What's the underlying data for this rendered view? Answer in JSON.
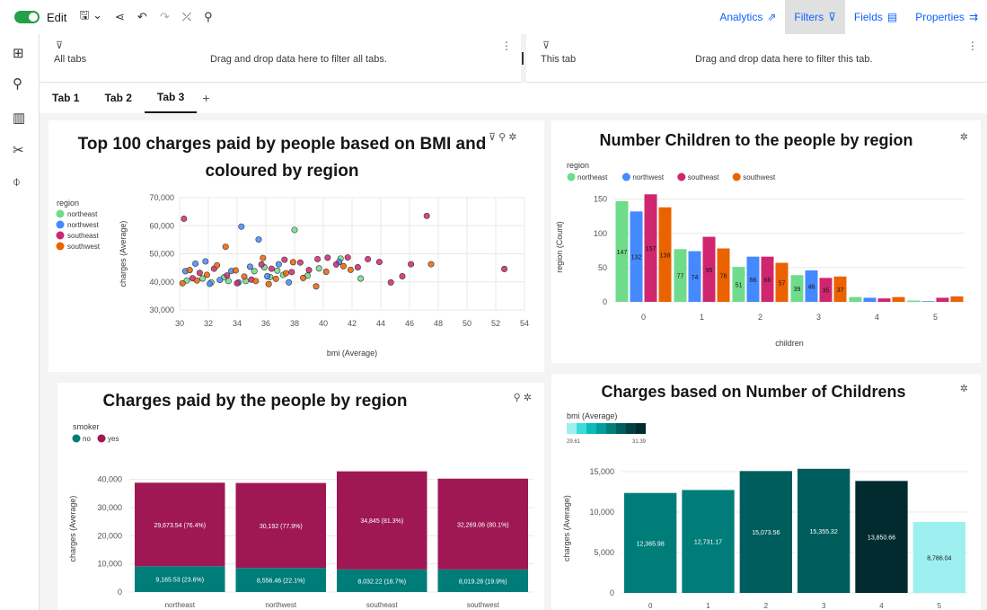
{
  "toolbar": {
    "edit_label": "Edit"
  },
  "nav": {
    "analytics": "Analytics",
    "filters": "Filters",
    "fields": "Fields",
    "properties": "Properties"
  },
  "filters": {
    "all_tabs_title": "All tabs",
    "all_tabs_drop": "Drag and drop data here to filter all tabs.",
    "this_tab_title": "This tab",
    "this_tab_drop": "Drag and drop data here to filter this tab."
  },
  "tabs": [
    "Tab 1",
    "Tab 2",
    "Tab 3"
  ],
  "active_tab": "Tab 3",
  "colors": {
    "northeast": "#6fdc8c",
    "northwest": "#4589ff",
    "southeast": "#d02670",
    "southwest": "#eb6200",
    "smoker_no": "#007d79",
    "smoker_yes": "#9f1853",
    "accent": "#0f62fe"
  },
  "chart_data": [
    {
      "type": "scatter",
      "title_line1": "Top 100 charges paid by people based on BMI and",
      "title_line2": "coloured by region",
      "xlabel": "bmi (Average)",
      "ylabel": "charges (Average)",
      "xlim": [
        30,
        54
      ],
      "ylim": [
        30000,
        70000
      ],
      "x_ticks": [
        "30",
        "32",
        "34",
        "36",
        "38",
        "40",
        "42",
        "44",
        "46",
        "48",
        "50",
        "52",
        "54"
      ],
      "y_ticks": [
        "30,000",
        "40,000",
        "50,000",
        "60,000",
        "70,000"
      ],
      "legend_title": "region",
      "legend": [
        "northeast",
        "northwest",
        "southeast",
        "southwest"
      ],
      "series": [
        {
          "name": "northeast",
          "points": [
            [
              30.5,
              40500
            ],
            [
              31.6,
              41200
            ],
            [
              32.2,
              39800
            ],
            [
              33.1,
              41600
            ],
            [
              34.6,
              40300
            ],
            [
              35.2,
              43800
            ],
            [
              35.9,
              45200
            ],
            [
              36.3,
              41700
            ],
            [
              36.8,
              44000
            ],
            [
              37.2,
              42500
            ],
            [
              38.0,
              58500
            ],
            [
              38.9,
              42200
            ],
            [
              39.7,
              44800
            ],
            [
              41.2,
              48300
            ],
            [
              42.6,
              41200
            ],
            [
              33.4,
              40300
            ]
          ]
        },
        {
          "name": "northwest",
          "points": [
            [
              30.4,
              43800
            ],
            [
              31.1,
              46500
            ],
            [
              31.8,
              47300
            ],
            [
              32.8,
              40700
            ],
            [
              33.6,
              43900
            ],
            [
              34.3,
              59700
            ],
            [
              34.9,
              45400
            ],
            [
              35.5,
              55100
            ],
            [
              36.1,
              42000
            ],
            [
              36.9,
              46300
            ],
            [
              37.6,
              39800
            ],
            [
              41.1,
              47100
            ],
            [
              32.1,
              39300
            ],
            [
              34.1,
              39800
            ]
          ]
        },
        {
          "name": "southeast",
          "points": [
            [
              30.3,
              62500
            ],
            [
              30.9,
              41300
            ],
            [
              31.4,
              43200
            ],
            [
              32.4,
              44700
            ],
            [
              33.3,
              42300
            ],
            [
              34.0,
              39500
            ],
            [
              35.0,
              40800
            ],
            [
              35.7,
              46200
            ],
            [
              36.4,
              44700
            ],
            [
              37.3,
              47900
            ],
            [
              37.8,
              43500
            ],
            [
              38.4,
              46900
            ],
            [
              39.0,
              44200
            ],
            [
              39.6,
              48100
            ],
            [
              40.3,
              48600
            ],
            [
              40.9,
              46200
            ],
            [
              41.7,
              48700
            ],
            [
              42.4,
              45200
            ],
            [
              43.1,
              48100
            ],
            [
              43.9,
              47100
            ],
            [
              44.7,
              39800
            ],
            [
              45.5,
              42000
            ],
            [
              46.1,
              46300
            ],
            [
              47.2,
              63500
            ],
            [
              52.6,
              44600
            ]
          ]
        },
        {
          "name": "southwest",
          "points": [
            [
              30.2,
              39500
            ],
            [
              30.7,
              44200
            ],
            [
              31.2,
              40500
            ],
            [
              31.9,
              42500
            ],
            [
              32.6,
              45900
            ],
            [
              33.2,
              52500
            ],
            [
              33.9,
              44100
            ],
            [
              34.5,
              41900
            ],
            [
              35.3,
              40300
            ],
            [
              35.8,
              48500
            ],
            [
              36.2,
              39200
            ],
            [
              36.7,
              41100
            ],
            [
              37.4,
              43100
            ],
            [
              37.9,
              47000
            ],
            [
              38.6,
              41400
            ],
            [
              39.5,
              38400
            ],
            [
              40.2,
              43600
            ],
            [
              41.4,
              45600
            ],
            [
              41.9,
              44300
            ],
            [
              47.5,
              46300
            ]
          ]
        }
      ]
    },
    {
      "type": "bar",
      "title": "Number Children to the people by region",
      "xlabel": "children",
      "ylabel": "region (Count)",
      "ylim": [
        0,
        160
      ],
      "y_ticks": [
        "0",
        "50",
        "100",
        "150"
      ],
      "legend_title": "region",
      "categories": [
        "0",
        "1",
        "2",
        "3",
        "4",
        "5"
      ],
      "series": [
        {
          "name": "northeast",
          "values": [
            147,
            77,
            51,
            39,
            7,
            2
          ]
        },
        {
          "name": "northwest",
          "values": [
            132,
            74,
            66,
            46,
            6,
            1
          ]
        },
        {
          "name": "southeast",
          "values": [
            157,
            95,
            66,
            35,
            5,
            6
          ]
        },
        {
          "name": "southwest",
          "values": [
            138,
            78,
            57,
            37,
            7,
            8
          ]
        }
      ],
      "data_labels": [
        [
          "147",
          "132",
          "157",
          "138"
        ],
        [
          "77",
          "74",
          "95",
          "78"
        ],
        [
          "51",
          "66",
          "66",
          "57"
        ],
        [
          "39",
          "46",
          "35",
          "37"
        ],
        [
          "",
          "",
          "",
          ""
        ],
        [
          "",
          "",
          "",
          ""
        ]
      ]
    },
    {
      "type": "bar",
      "stacked": true,
      "title": "Charges paid by the people by region",
      "ylabel": "charges (Average)",
      "ylim": [
        0,
        45000
      ],
      "y_ticks": [
        "0",
        "10,000",
        "20,000",
        "30,000",
        "40,000"
      ],
      "legend_title": "smoker",
      "legend": [
        "no",
        "yes"
      ],
      "categories": [
        "northeast",
        "northwest",
        "southeast",
        "southwest"
      ],
      "series": [
        {
          "name": "no",
          "values": [
            9165.53,
            8556.46,
            8032.22,
            8019.28
          ],
          "labels": [
            "9,165.53 (23.6%)",
            "8,556.46 (22.1%)",
            "8,032.22 (18.7%)",
            "8,019.28 (19.9%)"
          ]
        },
        {
          "name": "yes",
          "values": [
            29673.54,
            30192,
            34845,
            32269.06
          ],
          "labels": [
            "29,673.54 (76.4%)",
            "30,192 (77.9%)",
            "34,845 (81.3%)",
            "32,269.06 (80.1%)"
          ]
        }
      ]
    },
    {
      "type": "bar",
      "title": "Charges based on Number of Childrens",
      "ylabel": "charges (Average)",
      "ylim": [
        0,
        16000
      ],
      "y_ticks": [
        "0",
        "5,000",
        "10,000",
        "15,000"
      ],
      "legend_title": "bmi (Average)",
      "legend_min": "29.61",
      "legend_max": "31.39",
      "categories": [
        "0",
        "1",
        "2",
        "3",
        "4",
        "5"
      ],
      "values": [
        12365.98,
        12731.17,
        15073.56,
        15355.32,
        13850.66,
        8786.04
      ],
      "labels": [
        "12,365.98",
        "12,731.17",
        "15,073.56",
        "15,355.32",
        "13,850.66",
        "8,786.04"
      ],
      "bar_colors": [
        "#007d79",
        "#007d79",
        "#005d5d",
        "#005d5d",
        "#022b30",
        "#9ef0f0"
      ]
    }
  ]
}
